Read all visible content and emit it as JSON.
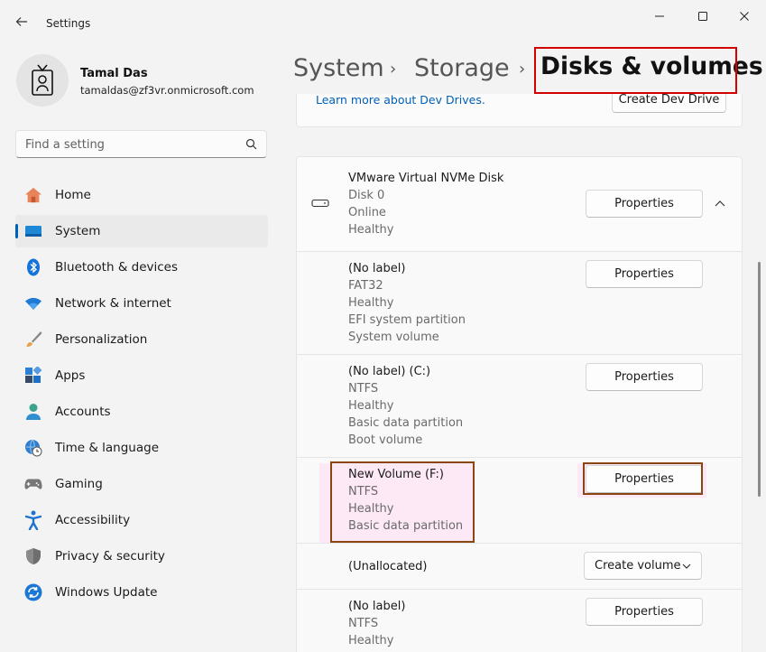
{
  "window": {
    "app_title": "Settings",
    "back_icon": "arrow-left-icon",
    "minimize_icon": "minimize-icon",
    "maximize_icon": "maximize-icon",
    "close_icon": "close-icon"
  },
  "profile": {
    "name": "Tamal Das",
    "email": "tamaldas@zf3vr.onmicrosoft.com"
  },
  "search": {
    "placeholder": "Find a setting"
  },
  "nav": {
    "items": [
      {
        "label": "Home",
        "icon": "home-icon"
      },
      {
        "label": "System",
        "icon": "monitor-icon",
        "active": true
      },
      {
        "label": "Bluetooth & devices",
        "icon": "bluetooth-icon"
      },
      {
        "label": "Network & internet",
        "icon": "wifi-icon"
      },
      {
        "label": "Personalization",
        "icon": "brush-icon"
      },
      {
        "label": "Apps",
        "icon": "apps-icon"
      },
      {
        "label": "Accounts",
        "icon": "person-icon"
      },
      {
        "label": "Time & language",
        "icon": "globe-clock-icon"
      },
      {
        "label": "Gaming",
        "icon": "gamepad-icon"
      },
      {
        "label": "Accessibility",
        "icon": "accessibility-icon"
      },
      {
        "label": "Privacy & security",
        "icon": "shield-icon"
      },
      {
        "label": "Windows Update",
        "icon": "refresh-icon"
      }
    ]
  },
  "breadcrumb": {
    "items": [
      "System",
      "Storage"
    ],
    "separator": "›",
    "current": "Disks & volumes"
  },
  "dev_drive": {
    "link": "Learn more about Dev Drives.",
    "button": "Create Dev Drive"
  },
  "disk": {
    "name": "VMware Virtual NVMe Disk",
    "number": "Disk 0",
    "state": "Online",
    "health": "Healthy",
    "button": "Properties",
    "icon": "drive-icon",
    "collapse_icon": "chevron-up-icon"
  },
  "volumes": [
    {
      "lines": [
        "(No label)",
        "FAT32",
        "Healthy",
        "EFI system partition",
        "System volume"
      ],
      "button": "Properties"
    },
    {
      "lines": [
        "(No label) (C:)",
        "NTFS",
        "Healthy",
        "Basic data partition",
        "Boot volume"
      ],
      "button": "Properties"
    },
    {
      "lines": [
        "New Volume (F:)",
        "NTFS",
        "Healthy",
        "Basic data partition"
      ],
      "button": "Properties"
    },
    {
      "lines": [
        "(Unallocated)"
      ],
      "button": "Create volume",
      "button_icon": "chevron-down-icon"
    },
    {
      "lines": [
        "(No label)",
        "NTFS",
        "Healthy"
      ],
      "button": "Properties"
    }
  ],
  "colors": {
    "accent": "#005fb8",
    "highlight_red": "#d40000",
    "highlight_brown": "#8b4513"
  }
}
